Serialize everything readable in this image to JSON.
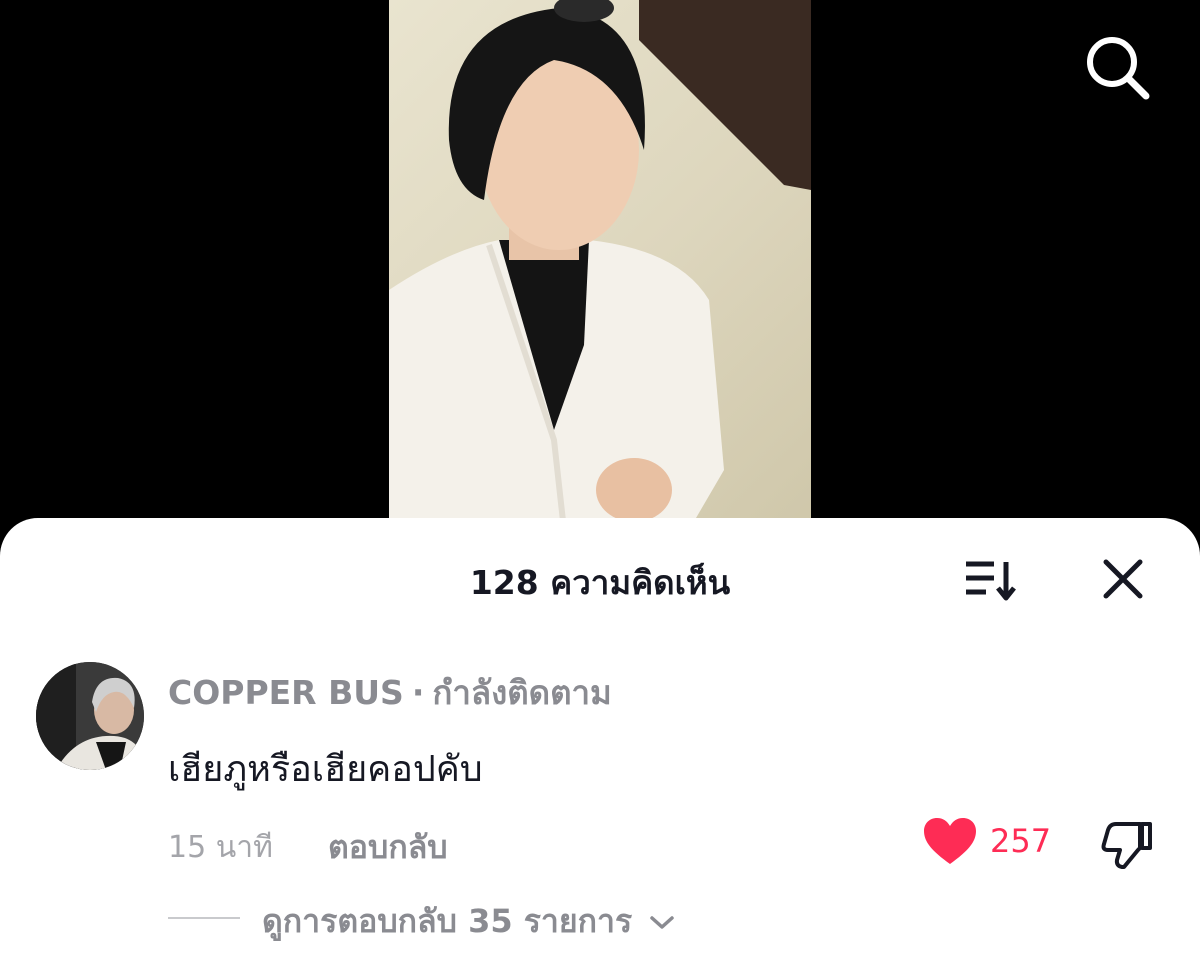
{
  "icons": {
    "search": "search-icon",
    "sort": "sort-icon",
    "close": "close-icon",
    "like": "heart-icon",
    "dislike": "thumbs-down-icon",
    "chevron": "chevron-down-icon"
  },
  "colors": {
    "accent": "#fe2c55",
    "muted_text": "#8a8b91",
    "primary_text": "#161823",
    "background": "#000000",
    "sheet_background": "#ffffff"
  },
  "comments_panel": {
    "title": "128 ความคิดเห็น"
  },
  "comment": {
    "author": "COPPER BUS",
    "separator": "·",
    "follow_status": "กำลังติดตาม",
    "text": "เฮียภูหรือเฮียคอปคับ",
    "time": "15 นาที",
    "reply_label": "ตอบกลับ",
    "like_count": "257",
    "liked": true,
    "view_replies_label": "ดูการตอบกลับ 35 รายการ"
  }
}
